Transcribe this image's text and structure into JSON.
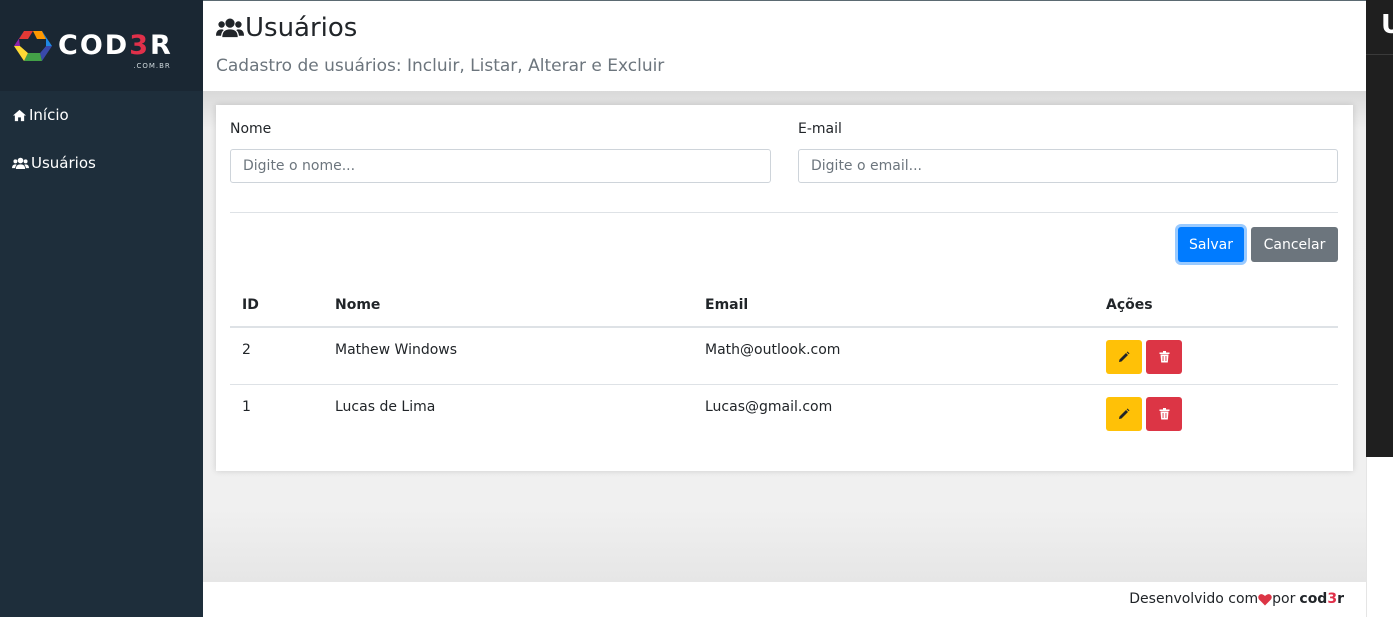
{
  "brand": {
    "logo_text_a": "COD",
    "logo_text_b": "3",
    "logo_text_c": "R",
    "logo_sub": ".COM.BR"
  },
  "sidebar": {
    "items": [
      {
        "label": "Início",
        "icon": "home-icon"
      },
      {
        "label": "Usuários",
        "icon": "users-icon"
      }
    ]
  },
  "header": {
    "title": "Usuários",
    "subtitle": "Cadastro de usuários: Incluir, Listar, Alterar e Excluir"
  },
  "form": {
    "name_label": "Nome",
    "name_placeholder": "Digite o nome...",
    "email_label": "E-mail",
    "email_placeholder": "Digite o email...",
    "save_label": "Salvar",
    "cancel_label": "Cancelar"
  },
  "table": {
    "headers": [
      "ID",
      "Nome",
      "Email",
      "Ações"
    ],
    "rows": [
      {
        "id": "2",
        "name": "Mathew Windows",
        "email": "Math@outlook.com"
      },
      {
        "id": "1",
        "name": "Lucas de Lima",
        "email": "Lucas@gmail.com"
      }
    ]
  },
  "footer": {
    "prefix": "Desenvolvido com",
    "middle": "por",
    "brand_a": "cod",
    "brand_b": "3",
    "brand_c": "r"
  },
  "right_strip": {
    "letter": "U"
  },
  "colors": {
    "sidebar": "#1e2e3b",
    "primary": "#007bff",
    "secondary": "#6c757d",
    "warning": "#ffc107",
    "danger": "#dc3545",
    "accent": "#e0304a"
  }
}
